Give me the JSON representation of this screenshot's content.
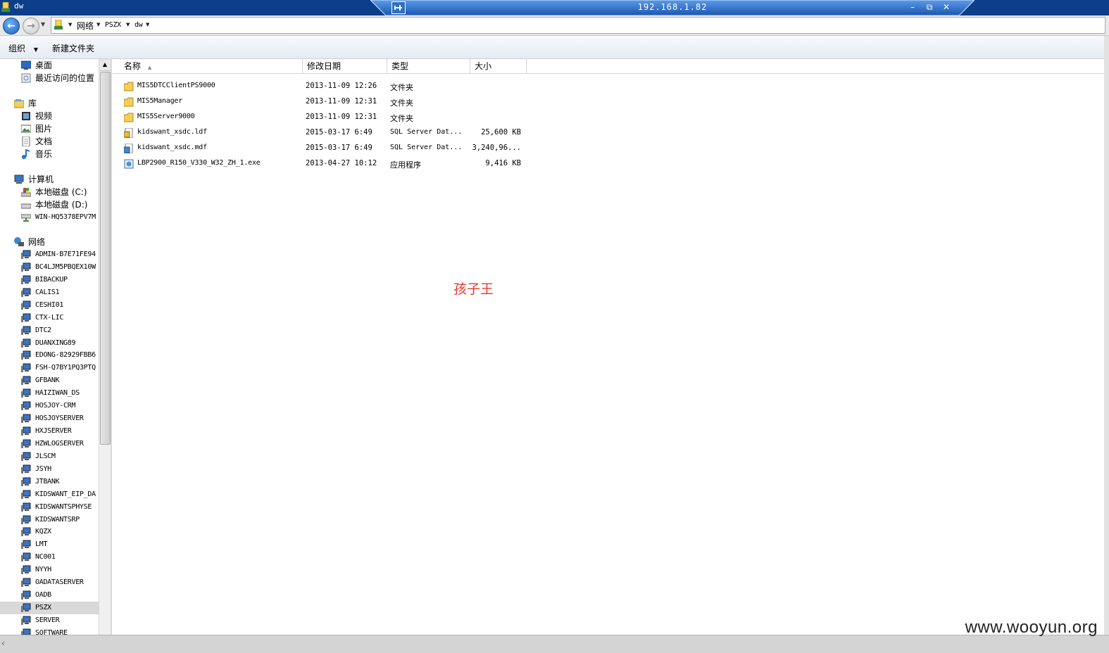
{
  "window": {
    "title": "dw"
  },
  "rdp": {
    "host": "192.168.1.82",
    "minimize": "–",
    "restore": "⧉",
    "close": "✕"
  },
  "address": {
    "crumbs": [
      "网络",
      "PSZX",
      "dw"
    ]
  },
  "toolbar": {
    "organize": "组织",
    "new_folder": "新建文件夹"
  },
  "nav": {
    "favorites": [
      {
        "label": "桌面",
        "icon": "desktop-icon"
      },
      {
        "label": "最近访问的位置",
        "icon": "recent-places-icon"
      }
    ],
    "libraries": {
      "label": "库",
      "items": [
        "视频",
        "图片",
        "文档",
        "音乐"
      ]
    },
    "computer": {
      "label": "计算机",
      "items": [
        "本地磁盘 (C:)",
        "本地磁盘 (D:)",
        "WIN-HQ5378EPV7M"
      ]
    },
    "network": {
      "label": "网络",
      "items": [
        "ADMIN-B7E71FE94",
        "BC4LJM5PBQEX10W",
        "BIBACKUP",
        "CALIS1",
        "CESHI01",
        "CTX-LIC",
        "DTC2",
        "DUANXING89",
        "EDONG-82929FBB6",
        "FSH-Q7BY1PQ3PTQ",
        "GFBANK",
        "HAIZIWAN_DS",
        "HOSJOY-CRM",
        "HOSJOYSERVER",
        "HXJSERVER",
        "HZWLOGSERVER",
        "JLSCM",
        "JSYH",
        "JTBANK",
        "KIDSWANT_EIP_DA",
        "KIDSWANTSPHYSE",
        "KIDSWANTSRP",
        "KQZX",
        "LMT",
        "NC001",
        "NYYH",
        "OADATASERVER",
        "OADB",
        "PSZX",
        "SERVER",
        "SOFTWARE"
      ],
      "selected": "PSZX"
    }
  },
  "columns": {
    "name": "名称",
    "modified": "修改日期",
    "type": "类型",
    "size": "大小"
  },
  "files": [
    {
      "name": "MIS5DTCClientPS9000",
      "modified": "2013-11-09 12:26",
      "type": "文件夹",
      "size": "",
      "icon": "folder-icon"
    },
    {
      "name": "MIS5Manager",
      "modified": "2013-11-09 12:31",
      "type": "文件夹",
      "size": "",
      "icon": "folder-icon"
    },
    {
      "name": "MIS5Server9000",
      "modified": "2013-11-09 12:31",
      "type": "文件夹",
      "size": "",
      "icon": "folder-icon"
    },
    {
      "name": "kidswant_xsdc.ldf",
      "modified": "2015-03-17 6:49",
      "type": "SQL Server Dat...",
      "size": "25,600 KB",
      "icon": "sql-log-file-icon"
    },
    {
      "name": "kidswant_xsdc.mdf",
      "modified": "2015-03-17 6:49",
      "type": "SQL Server Dat...",
      "size": "3,240,96...",
      "icon": "sql-data-file-icon"
    },
    {
      "name": "LBP2900_R150_V330_W32_ZH_1.exe",
      "modified": "2013-04-27 10:12",
      "type": "应用程序",
      "size": "9,416 KB",
      "icon": "exe-file-icon"
    }
  ],
  "overlay_text": "孩子王",
  "watermark": "www.wooyun.org"
}
